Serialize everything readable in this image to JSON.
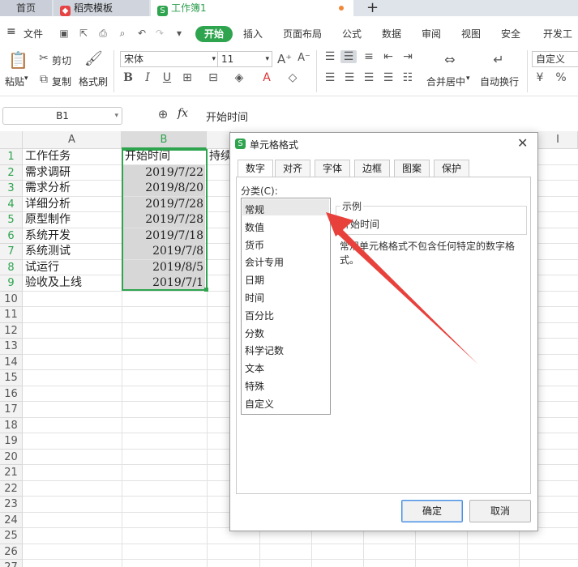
{
  "tabs": {
    "home": "首页",
    "docer": "稻壳模板",
    "workbook": "工作簿1",
    "new_tab": "+"
  },
  "menu": {
    "file": "文件",
    "items": [
      "开始",
      "插入",
      "页面布局",
      "公式",
      "数据",
      "审阅",
      "视图",
      "安全",
      "开发工"
    ]
  },
  "ribbon": {
    "paste": "粘贴",
    "cut": "剪切",
    "copy": "复制",
    "format_painter": "格式刷",
    "font_name": "宋体",
    "font_size": "11",
    "merge_center": "合并居中",
    "wrap_text": "自动换行",
    "number_format": "自定义"
  },
  "formula_bar": {
    "name_box": "B1",
    "fx": "fx",
    "content": "开始时间"
  },
  "sheet": {
    "columns": [
      "A",
      "B"
    ],
    "c_partial": "持续",
    "i_partial": "I",
    "rows": [
      "1",
      "2",
      "3",
      "4",
      "5",
      "6",
      "7",
      "8",
      "9",
      "10",
      "11",
      "12",
      "13",
      "14",
      "15",
      "16",
      "17",
      "18",
      "19",
      "20",
      "21",
      "22",
      "23",
      "24",
      "25",
      "26",
      "27"
    ],
    "col_a": [
      "工作任务",
      "需求调研",
      "需求分析",
      "详细分析",
      "原型制作",
      "系统开发",
      "系统测试",
      "试运行",
      "验收及上线"
    ],
    "col_b": [
      "开始时间",
      "2019/7/22",
      "2019/8/20",
      "2019/7/28",
      "2019/7/28",
      "2019/7/18",
      "2019/7/8",
      "2019/8/5",
      "2019/7/1"
    ]
  },
  "dialog": {
    "title": "单元格格式",
    "tabs": [
      "数字",
      "对齐",
      "字体",
      "边框",
      "图案",
      "保护"
    ],
    "category_label": "分类(C):",
    "categories": [
      "常规",
      "数值",
      "货币",
      "会计专用",
      "日期",
      "时间",
      "百分比",
      "分数",
      "科学记数",
      "文本",
      "特殊",
      "自定义"
    ],
    "sample_label": "示例",
    "sample_value": "开始时间",
    "description": "常规单元格格式不包含任何特定的数字格式。",
    "ok": "确定",
    "cancel": "取消"
  },
  "colors": {
    "accent": "#2fa44f",
    "arrow": "#e8413c"
  }
}
